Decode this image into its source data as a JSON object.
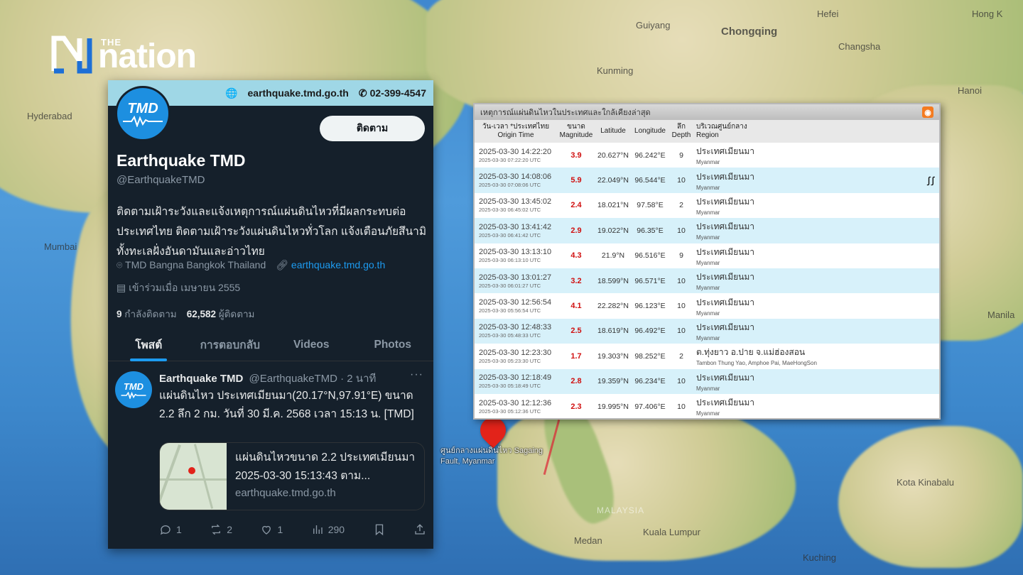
{
  "map": {
    "labels": [
      "Hefei",
      "Chongqing",
      "Changsha",
      "Hyderabad",
      "Mumbai",
      "Hong K",
      "Hanoi",
      "Manila",
      "MALAYSIA",
      "Kuala Lumpur",
      "Kota Kinabalu",
      "Medan",
      "Kuching",
      "Guiyang",
      "Kunming"
    ],
    "pin_label": "ศูนย์กลางแผ่นดินไหว Sagaing Fault, Myanmar"
  },
  "brand": {
    "the": "THE",
    "name": "nation"
  },
  "twitter": {
    "top_site": "earthquake.tmd.go.th",
    "top_phone": "02-399-4547",
    "avatar_text": "TMD",
    "follow_label": "ติดตาม",
    "name": "Earthquake TMD",
    "handle": "@EarthquakeTMD",
    "bio": "ติดตามเฝ้าระวังและแจ้งเหตุการณ์แผ่นดินไหวที่มีผลกระทบต่อประเทศไทย ติดตามเฝ้าระวังแผ่นดินไหวทั่วโลก แจ้งเตือนภัยสึนามิทั้งทะเลฝั่งอันดามันและอ่าวไทย",
    "location": "TMD Bangna Bangkok Thailand",
    "website": "earthquake.tmd.go.th",
    "joined": "เข้าร่วมเมื่อ เมษายน 2555",
    "following_count": "9",
    "following_label": "กำลังติดตาม",
    "followers_count": "62,582",
    "followers_label": "ผู้ติดตาม",
    "tabs": [
      "โพสต์",
      "การตอบกลับ",
      "Videos",
      "Photos"
    ],
    "post": {
      "name": "Earthquake TMD",
      "handle_time": "@EarthquakeTMD · 2 นาที",
      "more": "···",
      "text": "แผ่นดินไหว ประเทศเมียนมา(20.17°N,97.91°E) ขนาด 2.2  ลึก 2 กม. วันที่ 30 มี.ค. 2568 เวลา 15:13 น. [TMD]",
      "card_title": "แผ่นดินไหวขนาด 2.2 ประเทศเมียนมา 2025-03-30 15:13:43 ตาม...",
      "card_domain": "earthquake.tmd.go.th",
      "replies": "1",
      "reposts": "2",
      "likes": "1",
      "views": "290"
    }
  },
  "table": {
    "title": "เหตุการณ์แผ่นดินไหวในประเทศและใกล้เคียงล่าสุด",
    "headers": {
      "time_th": "วัน-เวลา *ประเทศไทย",
      "time_en": "Origin Time",
      "mag_th": "ขนาด",
      "mag_en": "Magnitude",
      "lat": "Latitude",
      "lon": "Longitude",
      "dep_th": "ลึก",
      "dep_en": "Depth",
      "reg_th": "บริเวณศูนย์กลาง",
      "reg_en": "Region"
    },
    "rows": [
      {
        "time": "2025-03-30 14:22:20",
        "utc": "2025-03-30 07:22:20 UTC",
        "mag": "3.9",
        "lat": "20.627°N",
        "lon": "96.242°E",
        "depth": "9",
        "region": "ประเทศเมียนมา",
        "region_en": "Myanmar"
      },
      {
        "time": "2025-03-30 14:08:06",
        "utc": "2025-03-30 07:08:06 UTC",
        "mag": "5.9",
        "lat": "22.049°N",
        "lon": "96.544°E",
        "depth": "10",
        "region": "ประเทศเมียนมา",
        "region_en": "Myanmar",
        "felt": "ꭍꭍ"
      },
      {
        "time": "2025-03-30 13:45:02",
        "utc": "2025-03-30 06:45:02 UTC",
        "mag": "2.4",
        "lat": "18.021°N",
        "lon": "97.58°E",
        "depth": "2",
        "region": "ประเทศเมียนมา",
        "region_en": "Myanmar"
      },
      {
        "time": "2025-03-30 13:41:42",
        "utc": "2025-03-30 06:41:42 UTC",
        "mag": "2.9",
        "lat": "19.022°N",
        "lon": "96.35°E",
        "depth": "10",
        "region": "ประเทศเมียนมา",
        "region_en": "Myanmar"
      },
      {
        "time": "2025-03-30 13:13:10",
        "utc": "2025-03-30 06:13:10 UTC",
        "mag": "4.3",
        "lat": "21.9°N",
        "lon": "96.516°E",
        "depth": "9",
        "region": "ประเทศเมียนมา",
        "region_en": "Myanmar"
      },
      {
        "time": "2025-03-30 13:01:27",
        "utc": "2025-03-30 06:01:27 UTC",
        "mag": "3.2",
        "lat": "18.599°N",
        "lon": "96.571°E",
        "depth": "10",
        "region": "ประเทศเมียนมา",
        "region_en": "Myanmar"
      },
      {
        "time": "2025-03-30 12:56:54",
        "utc": "2025-03-30 05:56:54 UTC",
        "mag": "4.1",
        "lat": "22.282°N",
        "lon": "96.123°E",
        "depth": "10",
        "region": "ประเทศเมียนมา",
        "region_en": "Myanmar"
      },
      {
        "time": "2025-03-30 12:48:33",
        "utc": "2025-03-30 05:48:33 UTC",
        "mag": "2.5",
        "lat": "18.619°N",
        "lon": "96.492°E",
        "depth": "10",
        "region": "ประเทศเมียนมา",
        "region_en": "Myanmar"
      },
      {
        "time": "2025-03-30 12:23:30",
        "utc": "2025-03-30 05:23:30 UTC",
        "mag": "1.7",
        "lat": "19.303°N",
        "lon": "98.252°E",
        "depth": "2",
        "region": "ต.ทุ่งยาว อ.ปาย จ.แม่ฮ่องสอน",
        "region_en": "Tambon Thung Yao, Amphoe Pai, MaeHongSon"
      },
      {
        "time": "2025-03-30 12:18:49",
        "utc": "2025-03-30 05:18:49 UTC",
        "mag": "2.8",
        "lat": "19.359°N",
        "lon": "96.234°E",
        "depth": "10",
        "region": "ประเทศเมียนมา",
        "region_en": "Myanmar"
      },
      {
        "time": "2025-03-30 12:12:36",
        "utc": "2025-03-30 05:12:36 UTC",
        "mag": "2.3",
        "lat": "19.995°N",
        "lon": "97.406°E",
        "depth": "10",
        "region": "ประเทศเมียนมา",
        "region_en": "Myanmar"
      }
    ]
  },
  "colors": {
    "accent": "#1d9bf0",
    "magnitude": "#d01010",
    "row_alt": "#d7f1fa",
    "twitter_bg": "#15202b"
  }
}
